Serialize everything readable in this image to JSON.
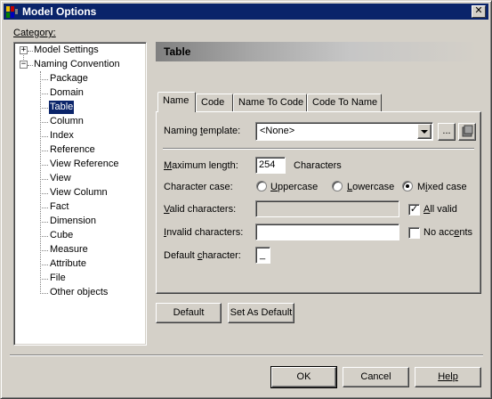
{
  "window": {
    "title": "Model Options",
    "close_glyph": "✕"
  },
  "category_label": "Category:",
  "tree": {
    "roots": [
      {
        "label": "Model Settings",
        "expander": "+"
      },
      {
        "label": "Naming Convention",
        "expander": "−"
      }
    ],
    "children": [
      "Package",
      "Domain",
      "Table",
      "Column",
      "Index",
      "Reference",
      "View Reference",
      "View",
      "View Column",
      "Fact",
      "Dimension",
      "Cube",
      "Measure",
      "Attribute",
      "File",
      "Other objects"
    ],
    "selected": "Table"
  },
  "banner_title": "Table",
  "tabs": [
    "Name",
    "Code",
    "Name To Code",
    "Code To Name"
  ],
  "form": {
    "naming_template_label": "Naming template:",
    "naming_template_value": "<None>",
    "ellipsis": "...",
    "max_length_label": "Maximum length:",
    "max_length_value": "254",
    "max_length_unit": "Characters",
    "char_case_label": "Character case:",
    "case_options": [
      "Uppercase",
      "Lowercase",
      "Mixed case"
    ],
    "case_selected": "Mixed case",
    "valid_chars_label": "Valid characters:",
    "valid_chars_value": "",
    "all_valid_label": "All valid",
    "all_valid_checked": true,
    "invalid_chars_label": "Invalid characters:",
    "invalid_chars_value": "",
    "no_accents_label": "No accents",
    "no_accents_checked": false,
    "default_char_label": "Default character:",
    "default_char_value": "_"
  },
  "buttons": {
    "default": "Default",
    "set_as_default": "Set As Default",
    "ok": "OK",
    "cancel": "Cancel",
    "help": "Help"
  },
  "colors": {
    "titlebar": "#0a246a",
    "selection": "#0a246a",
    "face": "#d4d0c8"
  }
}
